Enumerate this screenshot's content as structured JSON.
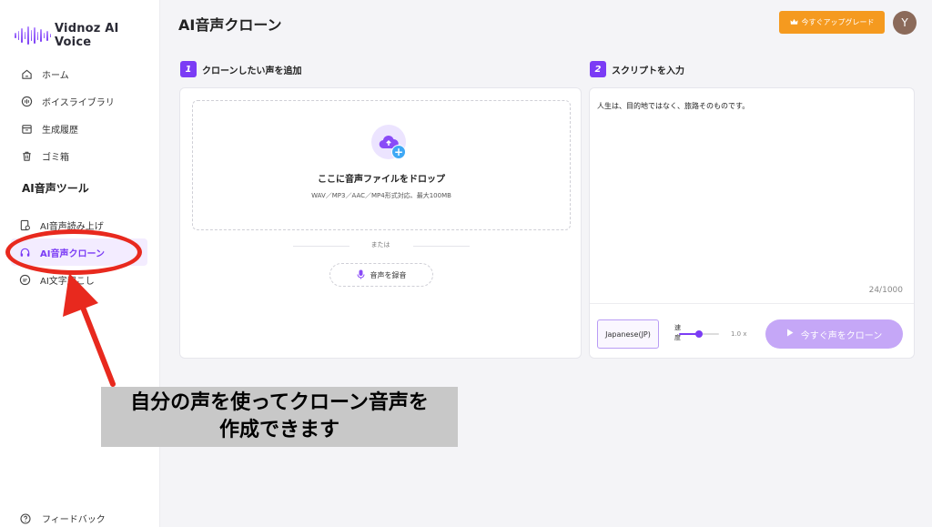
{
  "app": {
    "name": "Vidnoz AI Voice"
  },
  "sidebar": {
    "nav": [
      {
        "label": "ホーム",
        "icon": "home-icon"
      },
      {
        "label": "ボイスライブラリ",
        "icon": "voice-library-icon"
      },
      {
        "label": "生成履歴",
        "icon": "history-icon"
      },
      {
        "label": "ゴミ箱",
        "icon": "trash-icon"
      }
    ],
    "section_title": "AI音声ツール",
    "tools": [
      {
        "label": "AI音声読み上げ",
        "icon": "text-to-speech-icon"
      },
      {
        "label": "AI音声クローン",
        "icon": "voice-clone-icon",
        "active": true
      },
      {
        "label": "AI文字起こし",
        "icon": "transcribe-icon"
      }
    ],
    "feedback": "フィードバック"
  },
  "header": {
    "title": "AI音声クローン",
    "upgrade_label": "今すぐアップグレード",
    "avatar_initial": "Y"
  },
  "step1": {
    "number": "1",
    "title": "クローンしたい声を追加",
    "drop_title": "ここに音声ファイルをドロップ",
    "drop_formats": "WAV／MP3／AAC／MP4形式対応、最大100MB",
    "or": "または",
    "record_label": "音声を録音"
  },
  "step2": {
    "number": "2",
    "title": "スクリプトを入力",
    "script_text": "人生は、目的地ではなく、旅路そのものです。",
    "counter": "24/1000",
    "language": "Japanese(JP)",
    "speed_label": "速度",
    "speed_value": "1.0 x",
    "speed_level": 0.5,
    "clone_label": "今すぐ声をクローン"
  },
  "annotation": {
    "caption_line1": "自分の声を使ってクローン音声を",
    "caption_line2": "作成できます",
    "color": "#e8291e"
  },
  "colors": {
    "accent": "#7b3cf5",
    "upgrade": "#f59a1f"
  }
}
